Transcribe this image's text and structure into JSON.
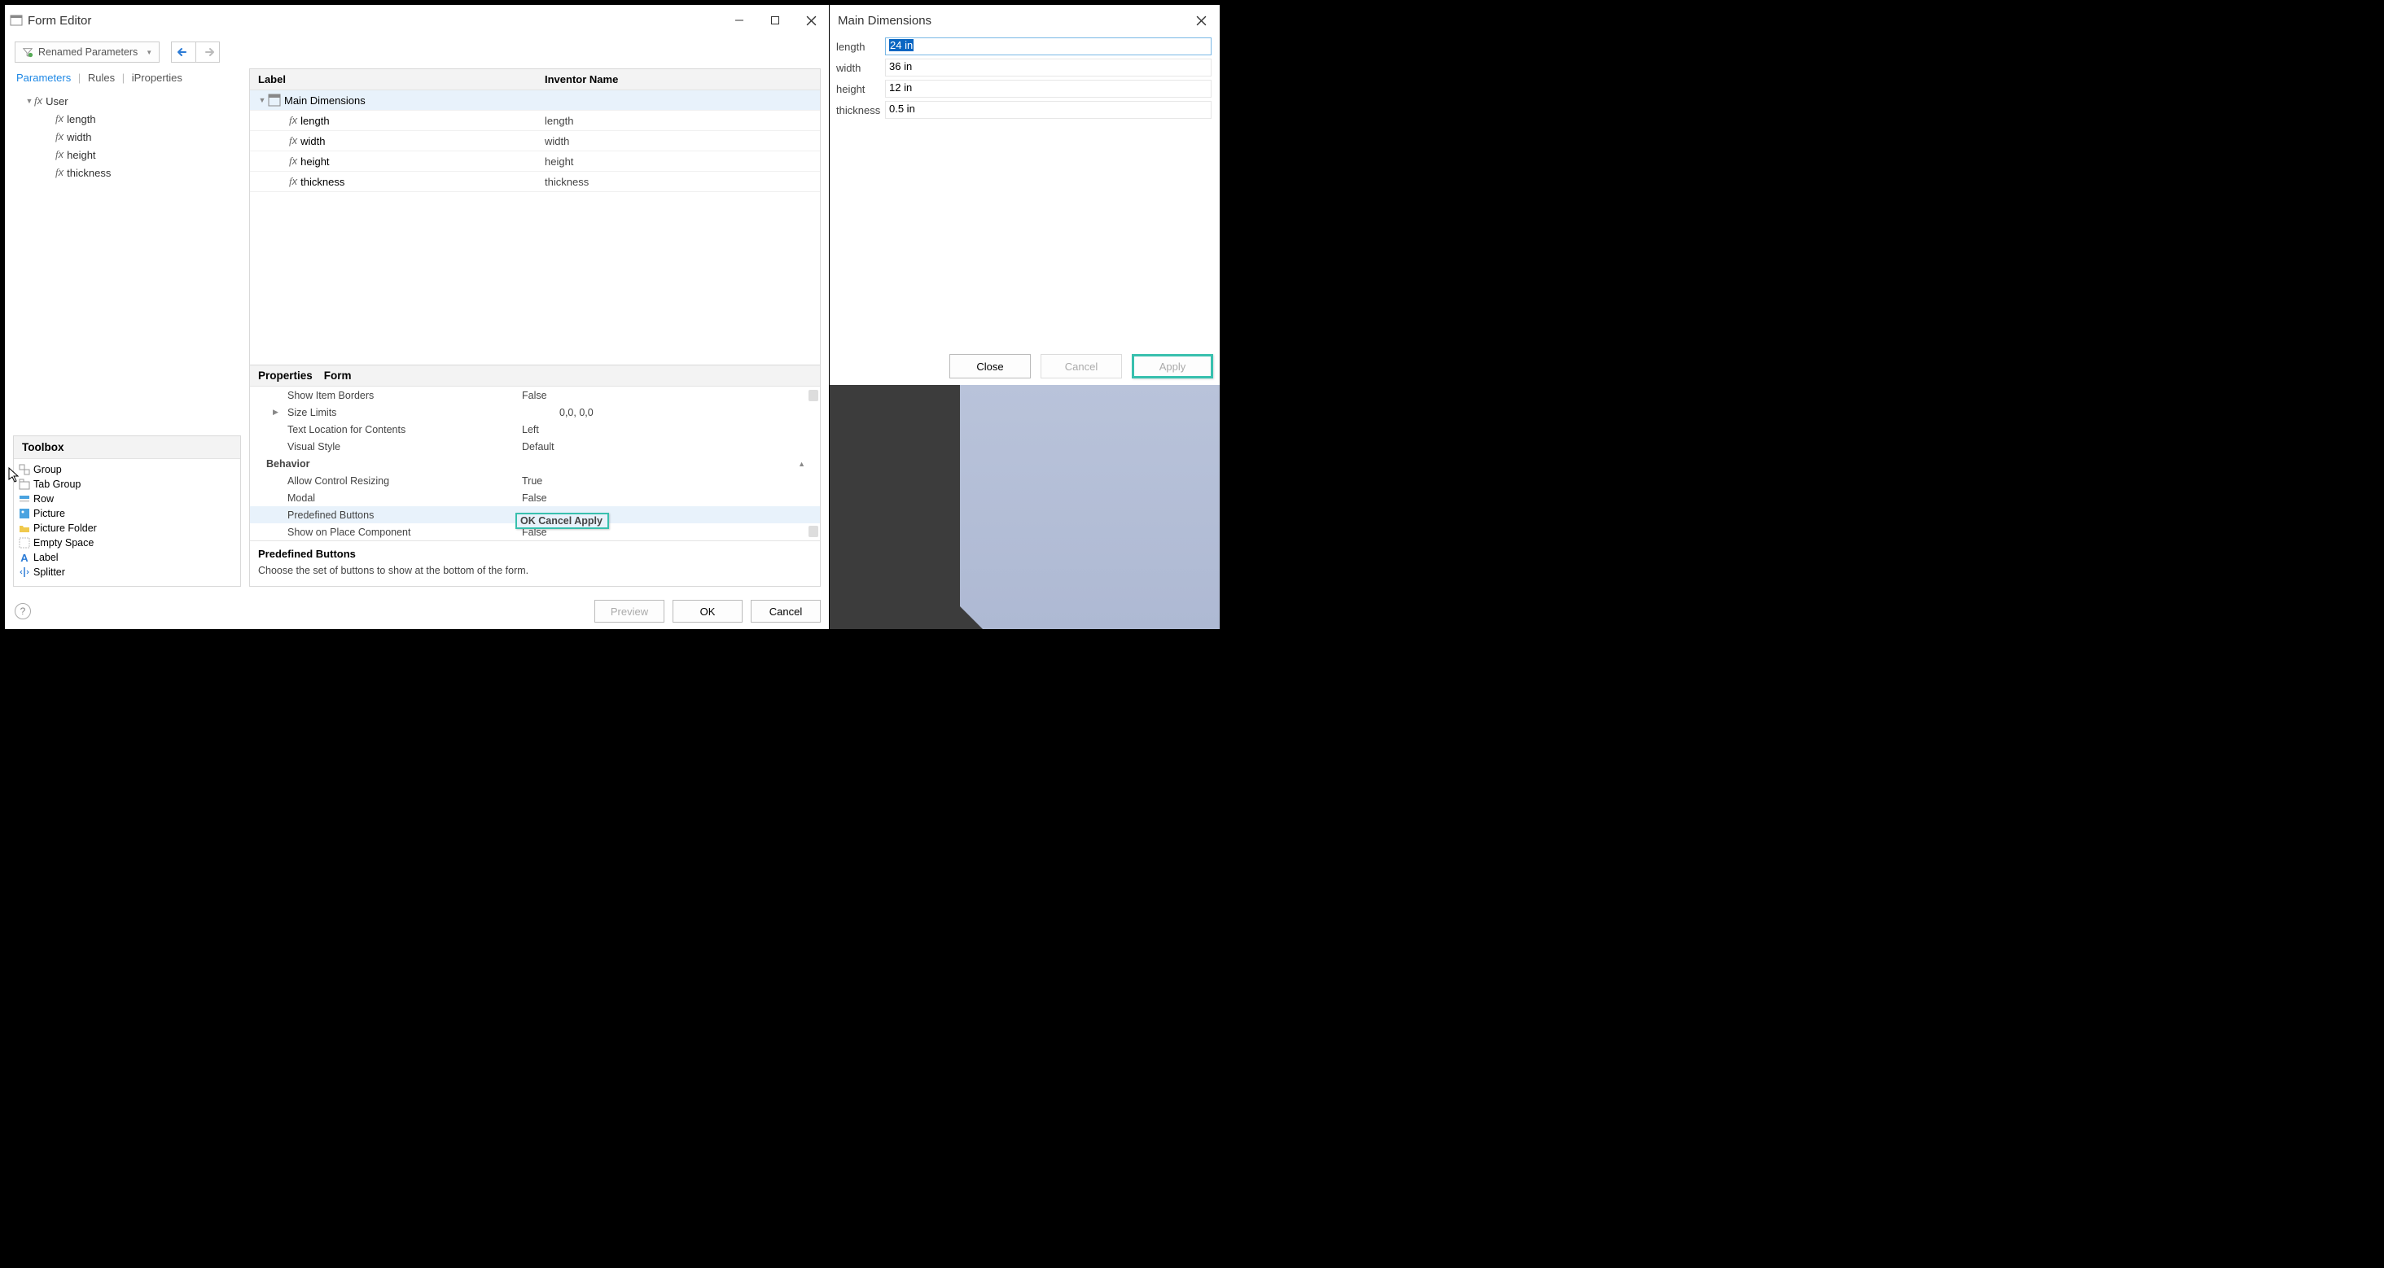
{
  "formEditor": {
    "title": "Form Editor",
    "renamedBtn": "Renamed Parameters",
    "tabs": {
      "parameters": "Parameters",
      "rules": "Rules",
      "iprops": "iProperties"
    },
    "tree": {
      "root": "User",
      "items": [
        "length",
        "width",
        "height",
        "thickness"
      ]
    },
    "toolbox": {
      "header": "Toolbox",
      "items": [
        "Group",
        "Tab Group",
        "Row",
        "Picture",
        "Picture Folder",
        "Empty Space",
        "Label",
        "Splitter"
      ]
    },
    "grid": {
      "colLabel": "Label",
      "colInv": "Inventor Name",
      "rootLabel": "Main Dimensions",
      "rows": [
        {
          "label": "length",
          "inv": "length"
        },
        {
          "label": "width",
          "inv": "width"
        },
        {
          "label": "height",
          "inv": "height"
        },
        {
          "label": "thickness",
          "inv": "thickness"
        }
      ]
    },
    "props": {
      "hdrProperties": "Properties",
      "hdrForm": "Form",
      "rows": [
        {
          "name": "Show Item Borders",
          "val": "False"
        },
        {
          "name": "Size Limits",
          "val": "0,0, 0,0",
          "exp": true
        },
        {
          "name": "Text Location for Contents",
          "val": "Left"
        },
        {
          "name": "Visual Style",
          "val": "Default"
        }
      ],
      "behaviorCat": "Behavior",
      "behaviorRows": [
        {
          "name": "Allow Control Resizing",
          "val": "True"
        },
        {
          "name": "Modal",
          "val": "False"
        },
        {
          "name": "Predefined Buttons",
          "val": "OK Cancel Apply",
          "highlighted": true
        },
        {
          "name": "Show on Place Component",
          "val": "False"
        }
      ],
      "descTitle": "Predefined Buttons",
      "descText": "Choose the set of buttons to show at the bottom of the form."
    },
    "footer": {
      "preview": "Preview",
      "ok": "OK",
      "cancel": "Cancel"
    }
  },
  "mainDims": {
    "title": "Main Dimensions",
    "fields": [
      {
        "label": "length",
        "value": "24 in",
        "active": true
      },
      {
        "label": "width",
        "value": "36 in"
      },
      {
        "label": "height",
        "value": "12 in"
      },
      {
        "label": "thickness",
        "value": "0.5 in"
      }
    ],
    "buttons": {
      "close": "Close",
      "cancel": "Cancel",
      "apply": "Apply"
    }
  }
}
